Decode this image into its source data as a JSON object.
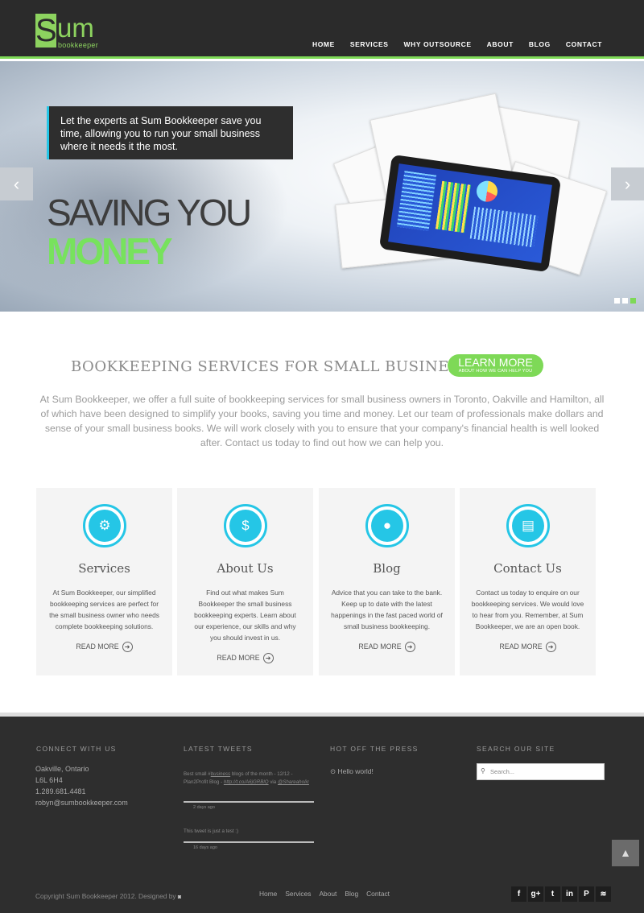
{
  "logo": {
    "big": "Sum",
    "letter_s": "S",
    "letters_um": "um",
    "sub": "bookkeeper"
  },
  "nav": [
    "HOME",
    "SERVICES",
    "WHY OUTSOURCE",
    "ABOUT",
    "BLOG",
    "CONTACT"
  ],
  "hero": {
    "callout": "Let the experts at Sum Bookkeeper save you time, allowing you to run your small business where it needs it the most.",
    "line1": "SAVING YOU",
    "line2": "MONEY",
    "prev": "‹",
    "next": "›"
  },
  "intro": {
    "title": "BOOKKEEPING SERVICES FOR SMALL BUSINESS",
    "learn_main": "LEARN MORE",
    "learn_sub": "ABOUT HOW WE CAN HELP YOU",
    "paragraph": "At Sum Bookkeeper, we offer a full suite of bookkeeping services for small business owners in Toronto, Oakville and Hamilton, all of which have been designed to simplify your books, saving you time and money. Let our team of professionals make dollars and sense of your small business books. We will work closely with you to ensure that your company's financial health is well looked after. Contact us today to find out how we can help you."
  },
  "cards": [
    {
      "icon": "⚙",
      "title": "Services",
      "text": "At Sum Bookkeeper, our simplified bookkeeping services are perfect for the small business owner who needs complete bookkeeping solutions.",
      "more": "READ MORE"
    },
    {
      "icon": "$",
      "title": "About Us",
      "text": "Find out what makes Sum Bookkeeper the small business bookkeeping experts. Learn about our experience, our skills and why you should invest in us.",
      "more": "READ MORE"
    },
    {
      "icon": "●",
      "title": "Blog",
      "text": "Advice that you can take to the bank. Keep up to date with the latest happenings in the fast paced world of small business bookkeeping.",
      "more": "READ MORE"
    },
    {
      "icon": "▤",
      "title": "Contact Us",
      "text": "Contact us today to enquire on our bookkeeping services. We would love to hear from you. Remember, at Sum Bookkeeper, we are an open book.",
      "more": "READ MORE"
    }
  ],
  "footer": {
    "connect_heading": "CONNECT WITH US",
    "tweets_heading": "LATEST TWEETS",
    "press_heading": "HOT OFF THE PRESS",
    "search_heading": "SEARCH OUR SITE",
    "city": "Oakville, Ontario",
    "postal": "L6L 6H4",
    "phone": "1.289.681.4481",
    "email": "robyn@sumbookkeeper.com",
    "tweet1_a": "Best small #",
    "tweet1_tag": "business",
    "tweet1_b": " blogs of the month - 12/12 - Plan2Profit Blog - ",
    "tweet1_link": "http://t.co/A6jGRBlQ",
    "tweet1_c": " via ",
    "tweet1_user": "@Shareaholic",
    "tweet1_date": "2 days ago",
    "tweet2": "This tweet is just a test :)",
    "tweet2_date": "16 days ago",
    "press_item": "Hello world!",
    "search_placeholder": "Search...",
    "copyright": "Copyright Sum Bookkeeper 2012. Designed by",
    "links": [
      "Home",
      "Services",
      "About",
      "Blog",
      "Contact"
    ],
    "social": [
      "f",
      "g+",
      "t",
      "in",
      "P",
      "rss"
    ]
  }
}
